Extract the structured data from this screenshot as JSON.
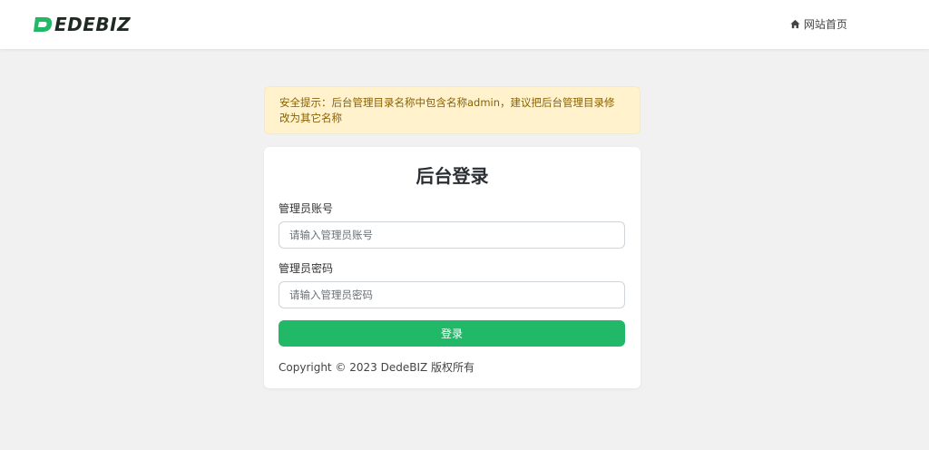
{
  "header": {
    "logo_text": "EDEBIZ",
    "home_link_label": "网站首页"
  },
  "alert": {
    "message": "安全提示：后台管理目录名称中包含名称admin，建议把后台管理目录修改为其它名称"
  },
  "login": {
    "title": "后台登录",
    "username_label": "管理员账号",
    "username_placeholder": "请输入管理员账号",
    "password_label": "管理员密码",
    "password_placeholder": "请输入管理员密码",
    "submit_label": "登录"
  },
  "footer": {
    "copyright": "Copyright © 2023 DedeBIZ 版权所有"
  },
  "colors": {
    "brand_green": "#21b968",
    "alert_bg": "#fff2cc",
    "alert_text": "#8a6100",
    "page_bg": "#f1f1f2"
  },
  "icons": {
    "logo": "dedebiz-logo-d",
    "home": "home-icon"
  }
}
